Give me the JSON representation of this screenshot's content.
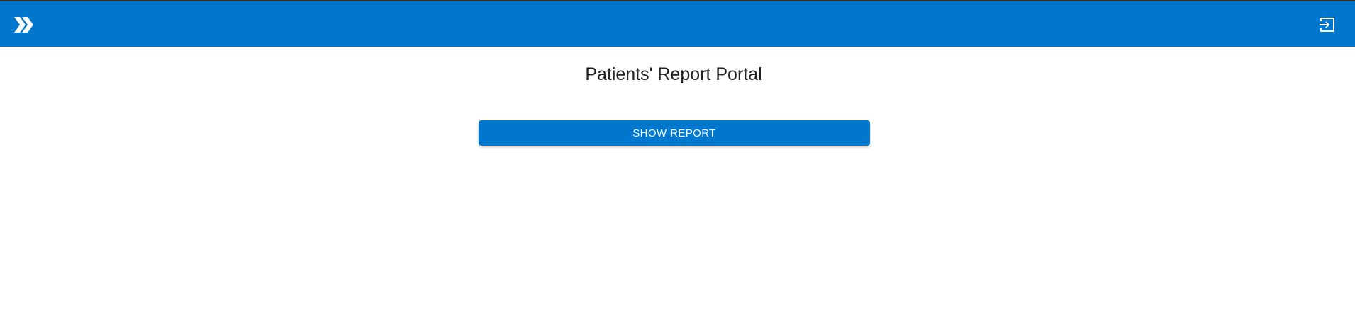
{
  "header": {
    "background_color": "#0077cc",
    "menu_icon": "double-chevron-right-icon",
    "logout_icon": "logout-icon"
  },
  "main": {
    "title": "Patients' Report Portal",
    "show_report_label": "SHOW REPORT",
    "button_color": "#0077cc"
  }
}
